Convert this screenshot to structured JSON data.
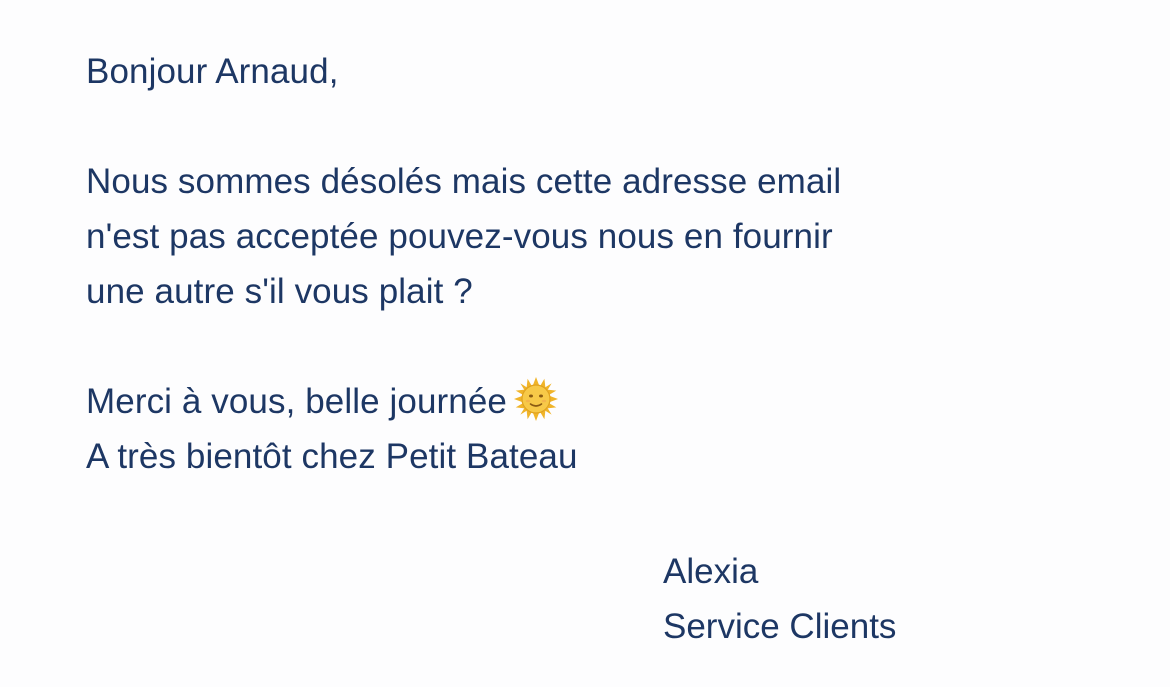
{
  "message": {
    "greeting": "Bonjour Arnaud,",
    "body_lines": [
      "Nous sommes désolés mais cette adresse email",
      "n'est pas acceptée pouvez-vous nous en fournir",
      "une autre s'il vous plait ?"
    ],
    "closing_line": "Merci à vous, belle journée",
    "closing_emoji": "sun-with-face-icon",
    "farewell": "A très bientôt chez Petit Bateau"
  },
  "signature": {
    "name": "Alexia",
    "department": "Service Clients"
  },
  "colors": {
    "text": "#1d3764",
    "background": "#fdfdfe",
    "sun": "#f2c232"
  }
}
